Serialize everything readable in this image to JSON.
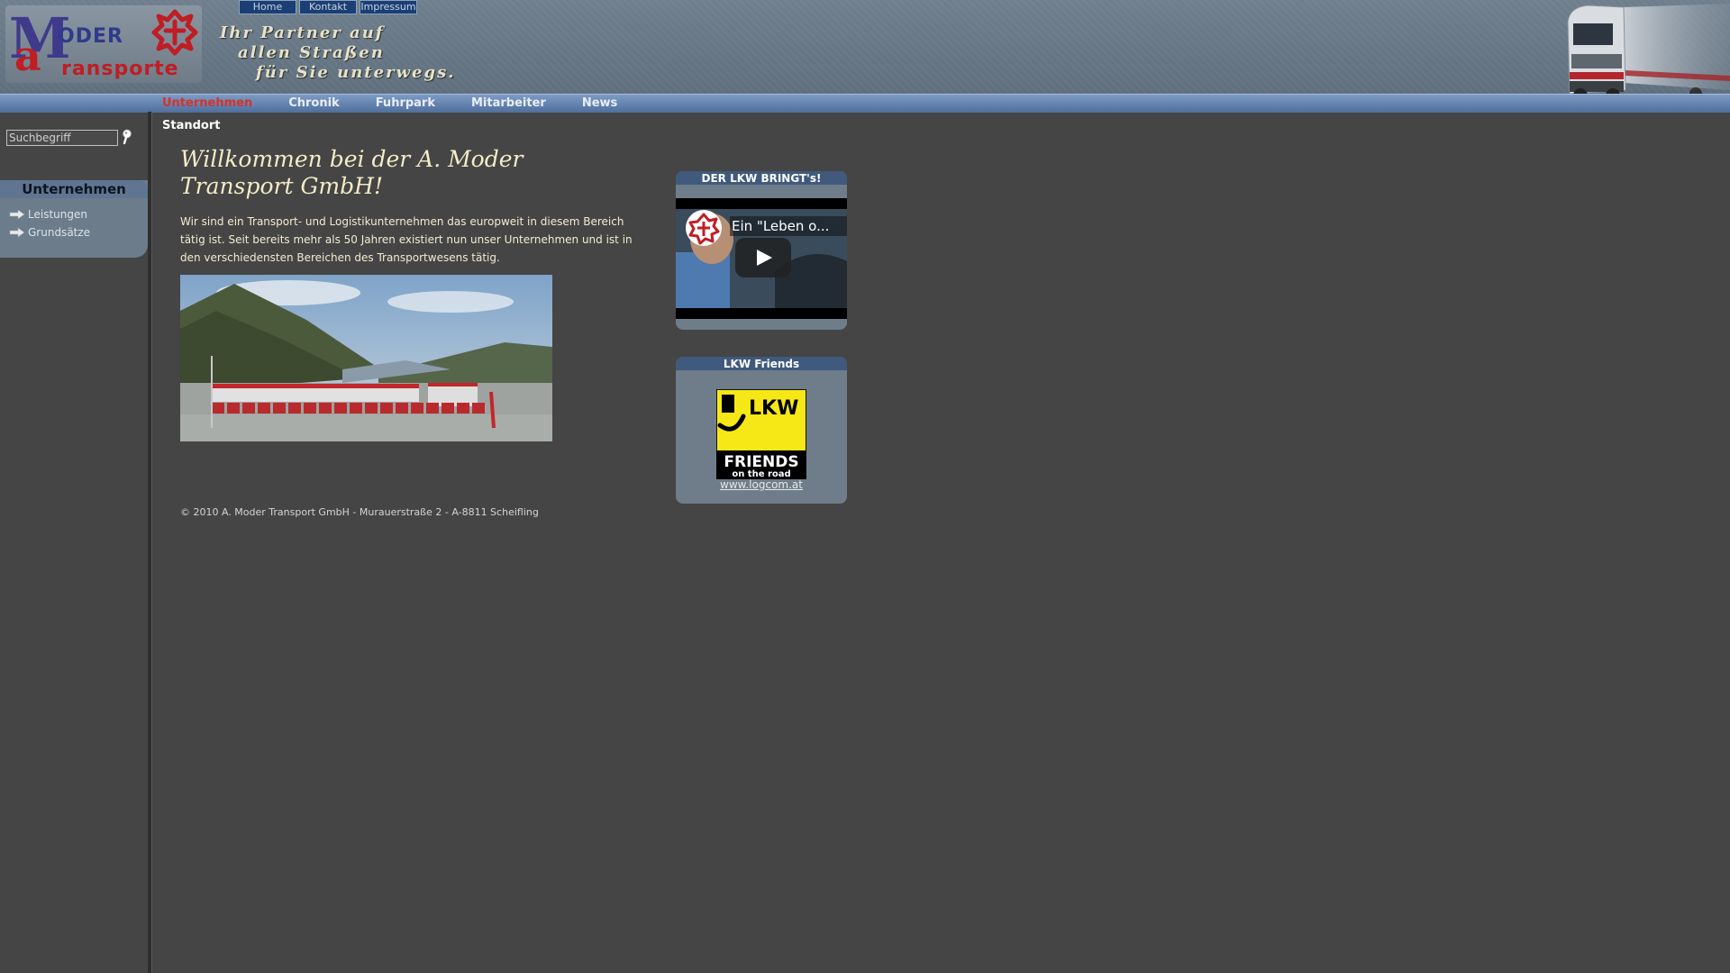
{
  "brand": {
    "logo_moder": "ODER",
    "logo_transporte": "ransporte",
    "slogan": [
      "Ihr Partner auf",
      "allen Straßen",
      "für Sie unterwegs."
    ]
  },
  "top_links": [
    {
      "label": "Home"
    },
    {
      "label": "Kontakt"
    },
    {
      "label": "Impressum"
    }
  ],
  "nav": {
    "items": [
      {
        "label": "Unternehmen",
        "active": true
      },
      {
        "label": "Chronik"
      },
      {
        "label": "Fuhrpark"
      },
      {
        "label": "Mitarbeiter"
      },
      {
        "label": "News"
      }
    ],
    "sub_items": [
      {
        "label": "Standort"
      }
    ]
  },
  "search": {
    "placeholder": "Suchbegriff",
    "value": "",
    "icon": "magnifier-icon"
  },
  "sidebar": {
    "title": "Unternehmen",
    "items": [
      {
        "label": "Leistungen",
        "icon": "arrow-right-icon"
      },
      {
        "label": "Grundsätze",
        "icon": "arrow-right-icon"
      }
    ]
  },
  "main": {
    "title_line1": "Willkommen bei der A. Moder",
    "title_line2": "Transport GmbH!",
    "intro": "Wir sind ein Transport- und Logistikunternehmen das  europweit in diesem Bereich tätig ist. Seit bereits mehr als 50 Jahren existiert nun unser Unternehmen und ist in den verschiedensten Bereichen des Transportwesens tätig.",
    "copyright": "© 2010 A. Moder Transport GmbH - Murauerstraße 2 - A-8811 Scheifling"
  },
  "video_box": {
    "title": "DER LKW BRINGT's!",
    "video_title": "Ein \"Leben o..."
  },
  "lkw_box": {
    "title": "LKW Friends",
    "logo_top": "LKW",
    "logo_bottom1": "FRIENDS",
    "logo_bottom2": "on the road",
    "link": "www.logcom.at"
  },
  "colors": {
    "background": "#454545",
    "header": "#6f7f8d",
    "nav_active": "#d8322a",
    "box_title": "#3f5a7c",
    "lkw_yellow": "#f5e816"
  }
}
